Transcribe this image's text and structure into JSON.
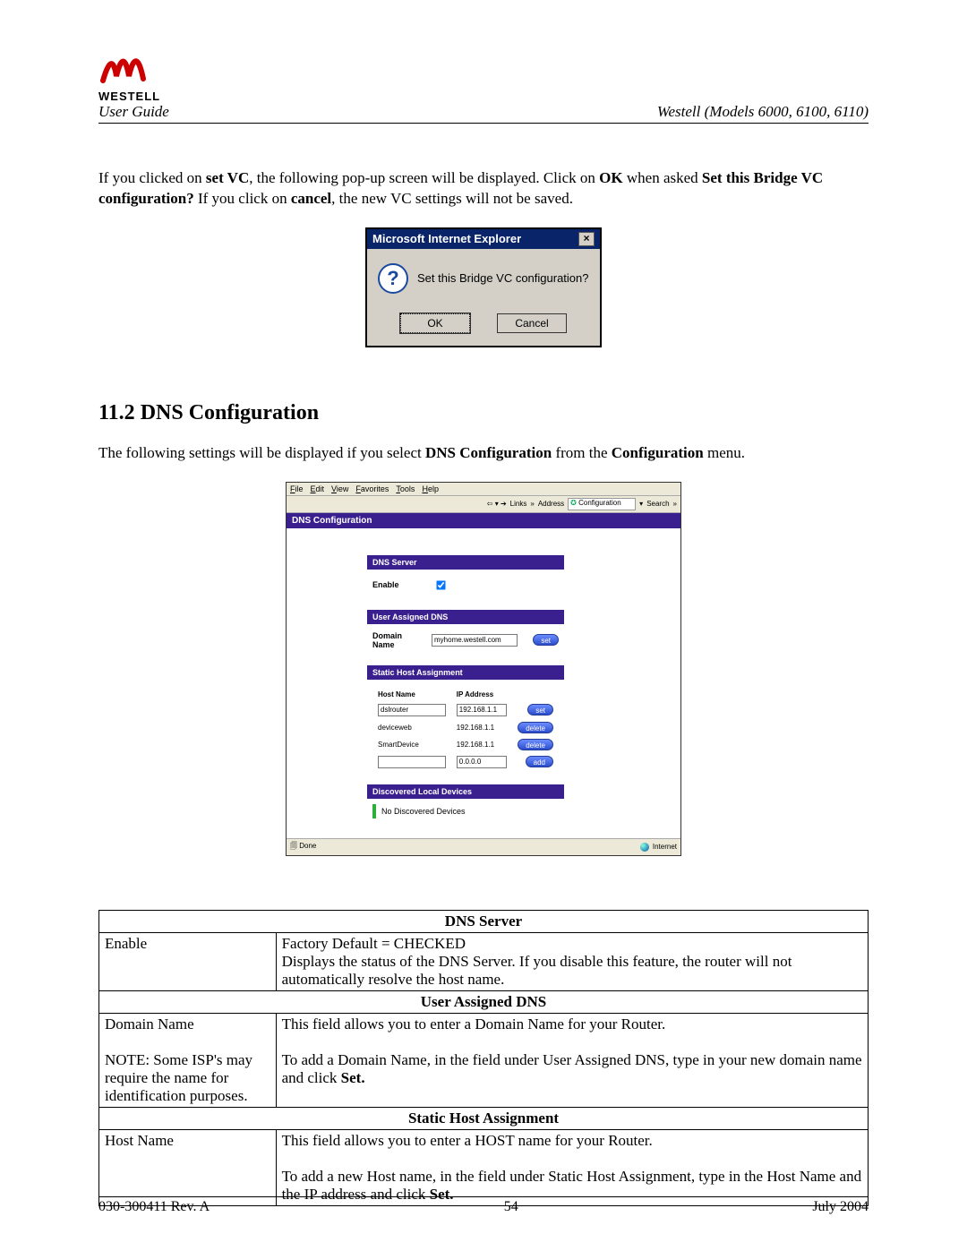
{
  "header": {
    "brand": "WESTELL",
    "user_guide": "User Guide",
    "models": "Westell (Models 6000, 6100, 6110)"
  },
  "intro": {
    "p1_prefix": "If you clicked on ",
    "p1_setvc": "set VC",
    "p1_mid1": ", the following pop-up screen will be displayed. Click on ",
    "p1_ok": "OK",
    "p1_mid2": " when asked ",
    "p1_question": "Set this Bridge VC configuration?",
    "p1_mid3": " If you click on ",
    "p1_cancel": "cancel",
    "p1_end": ", the new VC settings will not be saved."
  },
  "dialog": {
    "title": "Microsoft Internet Explorer",
    "message": "Set this Bridge VC configuration?",
    "ok": "OK",
    "cancel": "Cancel"
  },
  "section": {
    "number": "11.2",
    "title": "DNS Configuration",
    "p1_a": "The following settings will be displayed if you select ",
    "p1_b": "DNS Configuration",
    "p1_c": " from the ",
    "p1_d": "Configuration",
    "p1_e": " menu."
  },
  "ie": {
    "menu": [
      "File",
      "Edit",
      "View",
      "Favorites",
      "Tools",
      "Help"
    ],
    "links": "Links",
    "address_label": "Address",
    "address_value": "Configuration",
    "search": "Search",
    "done": "Done",
    "internet": "Internet"
  },
  "dns_page": {
    "title": "DNS Configuration",
    "server_hdr": "DNS Server",
    "enable_label": "Enable",
    "user_hdr": "User Assigned DNS",
    "domain_label": "Domain Name",
    "domain_value": "myhome.westell.com",
    "set": "set",
    "static_hdr": "Static Host Assignment",
    "col_host": "Host Name",
    "col_ip": "IP Address",
    "rows": [
      {
        "host": "dslrouter",
        "ip": "192.168.1.1",
        "btn": "set",
        "editable": true
      },
      {
        "host": "deviceweb",
        "ip": "192.168.1.1",
        "btn": "delete",
        "editable": false
      },
      {
        "host": "SmartDevice",
        "ip": "192.168.1.1",
        "btn": "delete",
        "editable": false
      },
      {
        "host": "",
        "ip": "0.0.0.0",
        "btn": "add",
        "editable": true
      }
    ],
    "disc_hdr": "Discovered Local Devices",
    "disc_msg": "No Discovered Devices"
  },
  "table": {
    "h1": "DNS Server",
    "r1_left": "Enable",
    "r1_right": "Factory Default = CHECKED\nDisplays the status of the DNS Server. If you disable this feature, the router will not automatically resolve the host name.",
    "h2": "User Assigned DNS",
    "r2_left": "Domain Name\n\nNOTE: Some ISP's may require the name for identification purposes.",
    "r2_right_a": "This field allows you to enter a Domain Name for your Router.",
    "r2_right_b": "To add a Domain Name, in the field under User Assigned DNS, type in your new domain name and click ",
    "r2_right_set": "Set.",
    "h3": "Static Host Assignment",
    "r3_left": "Host Name",
    "r3_right_a": "This field allows you to enter a HOST name for your Router.",
    "r3_right_b": "To add a new Host name, in the field under Static Host Assignment, type in the Host Name and the IP address and click ",
    "r3_right_set": "Set."
  },
  "footer": {
    "left": "030-300411 Rev. A",
    "center": "54",
    "right": "July 2004"
  }
}
